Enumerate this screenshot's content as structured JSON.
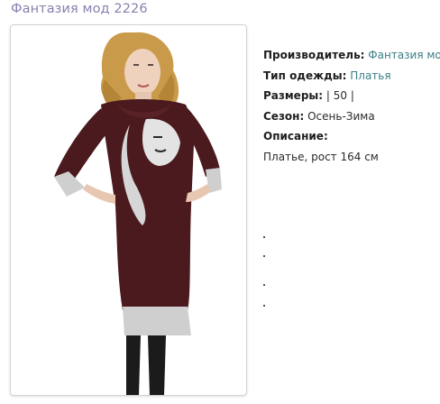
{
  "product": {
    "title": "Фантазия мод 2226"
  },
  "photo": {
    "icon": "dress-photo",
    "dress_color": "#4a1a1e",
    "trim_color": "#cfcfcf"
  },
  "details": {
    "manufacturer_label": "Производитель:",
    "manufacturer_value": "Фантазия мод",
    "type_label": "Тип одежды:",
    "type_value": "Платья",
    "sizes_label": "Размеры:",
    "sizes_value": "| 50 |",
    "season_label": "Сезон:",
    "season_value": "Осень-Зима",
    "description_label": "Описание:",
    "description_value": "Платье, рост 164 см"
  },
  "colors": {
    "title": "#8a7fb0",
    "link": "#3a7f85"
  }
}
